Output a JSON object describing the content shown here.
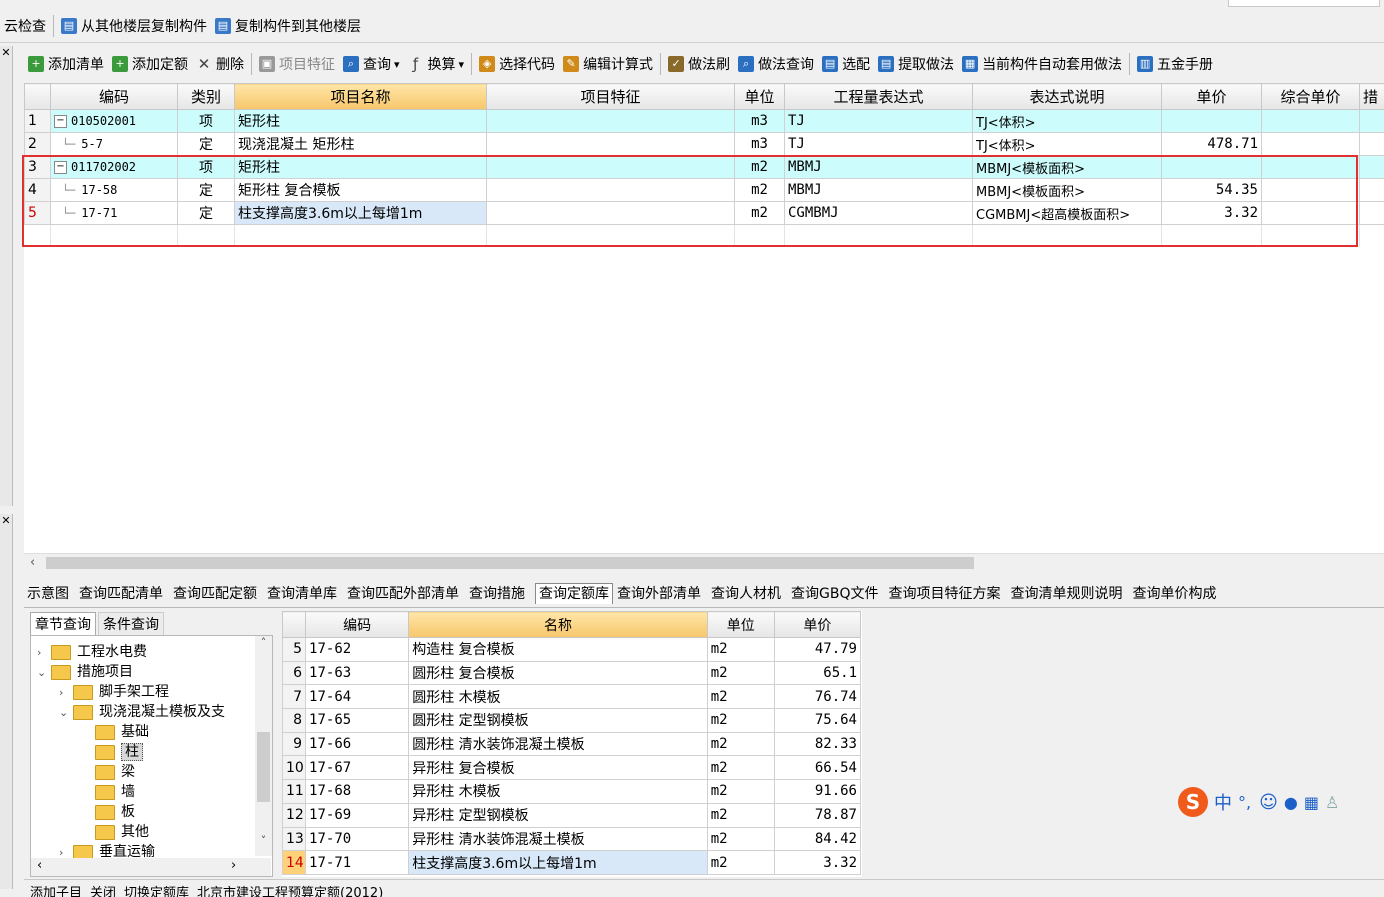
{
  "toolbar1": {
    "cloud_check": "云检查",
    "copy_from": "从其他楼层复制构件",
    "copy_to": "复制构件到其他楼层"
  },
  "toolbar2": [
    {
      "label": "添加清单",
      "icon": "add-list-icon"
    },
    {
      "label": "添加定额",
      "icon": "add-quota-icon"
    },
    {
      "label": "删除",
      "icon": "delete-icon"
    },
    {
      "label": "项目特征",
      "icon": "feature-icon"
    },
    {
      "label": "查询",
      "icon": "search-icon"
    },
    {
      "label": "换算",
      "icon": "formula-icon"
    },
    {
      "label": "选择代码",
      "icon": "select-code-icon"
    },
    {
      "label": "编辑计算式",
      "icon": "edit-formula-icon"
    },
    {
      "label": "做法刷",
      "icon": "brush-icon"
    },
    {
      "label": "做法查询",
      "icon": "method-query-icon"
    },
    {
      "label": "选配",
      "icon": "match-icon"
    },
    {
      "label": "提取做法",
      "icon": "extract-icon"
    },
    {
      "label": "当前构件自动套用做法",
      "icon": "auto-apply-icon"
    },
    {
      "label": "五金手册",
      "icon": "manual-icon"
    }
  ],
  "grid": {
    "headers": [
      "编码",
      "类别",
      "项目名称",
      "项目特征",
      "单位",
      "工程量表达式",
      "表达式说明",
      "单价",
      "综合单价",
      "措"
    ],
    "rows": [
      {
        "no": "1",
        "code": "010502001",
        "type": "项",
        "name": "矩形柱",
        "feature": "",
        "unit": "m3",
        "expr": "TJ",
        "desc": "TJ<体积>",
        "price": "",
        "comp": ""
      },
      {
        "no": "2",
        "code": "5-7",
        "type": "定",
        "name": "现浇混凝土 矩形柱",
        "feature": "",
        "unit": "m3",
        "expr": "TJ",
        "desc": "TJ<体积>",
        "price": "478.71",
        "comp": ""
      },
      {
        "no": "3",
        "code": "011702002",
        "type": "项",
        "name": "矩形柱",
        "feature": "",
        "unit": "m2",
        "expr": "MBMJ",
        "desc": "MBMJ<模板面积>",
        "price": "",
        "comp": ""
      },
      {
        "no": "4",
        "code": "17-58",
        "type": "定",
        "name": "矩形柱 复合模板",
        "feature": "",
        "unit": "m2",
        "expr": "MBMJ",
        "desc": "MBMJ<模板面积>",
        "price": "54.35",
        "comp": ""
      },
      {
        "no": "5",
        "code": "17-71",
        "type": "定",
        "name": "柱支撑高度3.6m以上每增1m",
        "feature": "",
        "unit": "m2",
        "expr": "CGMBMJ",
        "desc": "CGMBMJ<超高模板面积>",
        "price": "3.32",
        "comp": ""
      }
    ]
  },
  "bottom_tabs": [
    "示意图",
    "查询匹配清单",
    "查询匹配定额",
    "查询清单库",
    "查询匹配外部清单",
    "查询措施",
    "查询定额库",
    "查询外部清单",
    "查询人材机",
    "查询GBQ文件",
    "查询项目特征方案",
    "查询清单规则说明",
    "查询单价构成"
  ],
  "left_tabs": [
    "章节查询",
    "条件查询"
  ],
  "tree": [
    {
      "label": "工程水电费",
      "level": 0,
      "arrow": "›"
    },
    {
      "label": "措施项目",
      "level": 0,
      "arrow": "⌄"
    },
    {
      "label": "脚手架工程",
      "level": 1,
      "arrow": "›"
    },
    {
      "label": "现浇混凝土模板及支",
      "level": 1,
      "arrow": "⌄"
    },
    {
      "label": "基础",
      "level": 2,
      "arrow": ""
    },
    {
      "label": "柱",
      "level": 2,
      "arrow": ""
    },
    {
      "label": "梁",
      "level": 2,
      "arrow": ""
    },
    {
      "label": "墙",
      "level": 2,
      "arrow": ""
    },
    {
      "label": "板",
      "level": 2,
      "arrow": ""
    },
    {
      "label": "其他",
      "level": 2,
      "arrow": ""
    },
    {
      "label": "垂直运输",
      "level": 1,
      "arrow": "›"
    }
  ],
  "quota": {
    "headers": [
      "编码",
      "名称",
      "单位",
      "单价"
    ],
    "rows": [
      {
        "no": "5",
        "code": "17-62",
        "name": "构造柱 复合模板",
        "unit": "m2",
        "price": "47.79"
      },
      {
        "no": "6",
        "code": "17-63",
        "name": "圆形柱 复合模板",
        "unit": "m2",
        "price": "65.1"
      },
      {
        "no": "7",
        "code": "17-64",
        "name": "圆形柱 木模板",
        "unit": "m2",
        "price": "76.74"
      },
      {
        "no": "8",
        "code": "17-65",
        "name": "圆形柱 定型钢模板",
        "unit": "m2",
        "price": "75.64"
      },
      {
        "no": "9",
        "code": "17-66",
        "name": "圆形柱 清水装饰混凝土模板",
        "unit": "m2",
        "price": "82.33"
      },
      {
        "no": "10",
        "code": "17-67",
        "name": "异形柱 复合模板",
        "unit": "m2",
        "price": "66.54"
      },
      {
        "no": "11",
        "code": "17-68",
        "name": "异形柱 木模板",
        "unit": "m2",
        "price": "91.66"
      },
      {
        "no": "12",
        "code": "17-69",
        "name": "异形柱 定型钢模板",
        "unit": "m2",
        "price": "78.87"
      },
      {
        "no": "13",
        "code": "17-70",
        "name": "异形柱 清水装饰混凝土模板",
        "unit": "m2",
        "price": "84.42"
      },
      {
        "no": "14",
        "code": "17-71",
        "name": "柱支撑高度3.6m以上每增1m",
        "unit": "m2",
        "price": "3.32"
      }
    ]
  },
  "status": {
    "add_child": "添加子目",
    "close": "关闭",
    "switch": "切换定额库",
    "library": "北京市建设工程预算定额(2012)"
  },
  "ime": {
    "logo": "S",
    "lang": "中",
    "punct": "°,"
  },
  "colors": {
    "xiang_row": "#ccfcfc",
    "header_highlight": "#f7c66b",
    "selection_box": "#e03030",
    "ime_orange": "#f05a1a"
  }
}
